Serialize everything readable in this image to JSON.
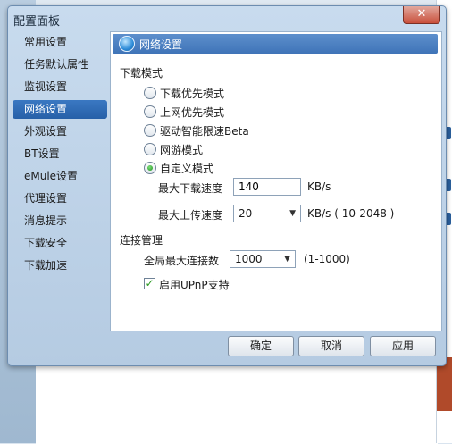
{
  "dialog": {
    "title": "配置面板",
    "close": "✕"
  },
  "nav": {
    "items": [
      {
        "label": "常用设置"
      },
      {
        "label": "任务默认属性"
      },
      {
        "label": "监视设置"
      },
      {
        "label": "网络设置",
        "active": true
      },
      {
        "label": "外观设置"
      },
      {
        "label": "BT设置"
      },
      {
        "label": "eMule设置"
      },
      {
        "label": "代理设置"
      },
      {
        "label": "消息提示"
      },
      {
        "label": "下载安全"
      },
      {
        "label": "下载加速"
      }
    ]
  },
  "panel": {
    "title": "网络设置",
    "download_mode": {
      "heading": "下载模式",
      "options": [
        {
          "label": "下载优先模式",
          "checked": false
        },
        {
          "label": "上网优先模式",
          "checked": false
        },
        {
          "label": "驱动智能限速Beta",
          "checked": false
        },
        {
          "label": "网游模式",
          "checked": false
        },
        {
          "label": "自定义模式",
          "checked": true
        }
      ],
      "max_download": {
        "label": "最大下载速度",
        "value": "140",
        "unit": "KB/s"
      },
      "max_upload": {
        "label": "最大上传速度",
        "value": "20",
        "unit": "KB/s ( 10-2048 )"
      }
    },
    "connection": {
      "heading": "连接管理",
      "max_connections": {
        "label": "全局最大连接数",
        "value": "1000",
        "range": "(1-1000)"
      },
      "upnp": {
        "label": "启用UPnP支持",
        "checked": true
      }
    }
  },
  "footer": {
    "ok": "确定",
    "cancel": "取消",
    "apply": "应用"
  },
  "colors": {
    "accent": "#2760a8",
    "check_green": "#2a9a20",
    "close_red": "#c9503c"
  }
}
